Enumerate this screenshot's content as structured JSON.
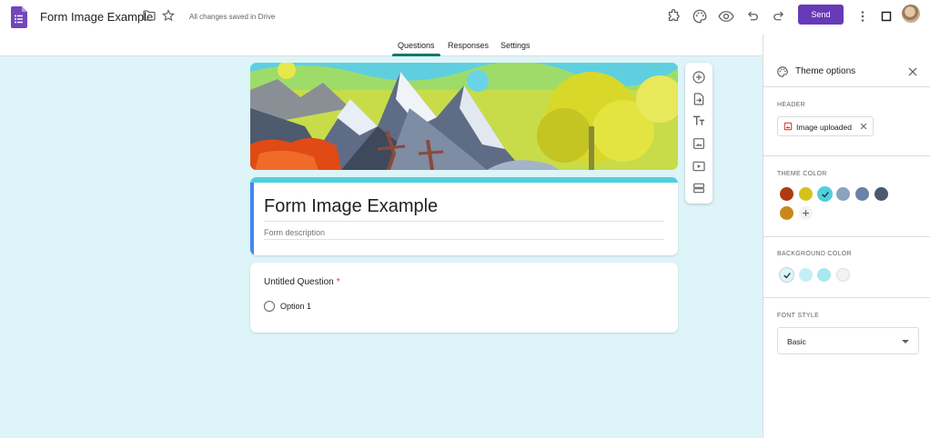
{
  "app": {
    "document_title": "Form Image Example",
    "save_status": "All changes saved in Drive",
    "brand_color": "#673ab7",
    "icons": [
      "forms-logo-icon",
      "folder-icon",
      "star-icon",
      "addon-icon",
      "palette-icon",
      "preview-eye-icon",
      "undo-icon",
      "redo-icon",
      "more-vert-icon",
      "stop-square-icon"
    ]
  },
  "toolbar": {
    "send_label": "Send"
  },
  "tabs": [
    {
      "label": "Questions",
      "active": true
    },
    {
      "label": "Responses",
      "active": false
    },
    {
      "label": "Settings",
      "active": false
    }
  ],
  "form": {
    "title": "Form Image Example",
    "description_placeholder": "Form description",
    "accent_color": "#4fd0dc",
    "question": {
      "title": "Untitled Question",
      "required_mark": "*",
      "options": [
        "Option 1"
      ]
    }
  },
  "floating_toolbar": {
    "icons": [
      "add-question-icon",
      "import-questions-icon",
      "add-title-text-icon",
      "add-image-icon",
      "add-video-icon",
      "add-section-icon"
    ]
  },
  "theme_panel": {
    "title": "Theme options",
    "header": {
      "label": "HEADER",
      "chip_label": "Image uploaded"
    },
    "theme_color": {
      "label": "THEME COLOR",
      "colors": [
        "#b03a10",
        "#d4c41a",
        "#4fd0dc",
        "#8aa3be",
        "#6a82a8",
        "#4c586e",
        "#c8891c"
      ],
      "selected_index": 2
    },
    "background_color": {
      "label": "BACKGROUND COLOR",
      "colors": [
        "#ddf4f8",
        "#c2eff5",
        "#a8e8f0",
        "#f1f3f4"
      ],
      "selected_index": 0
    },
    "font_style": {
      "label": "FONT STYLE",
      "value": "Basic"
    }
  }
}
